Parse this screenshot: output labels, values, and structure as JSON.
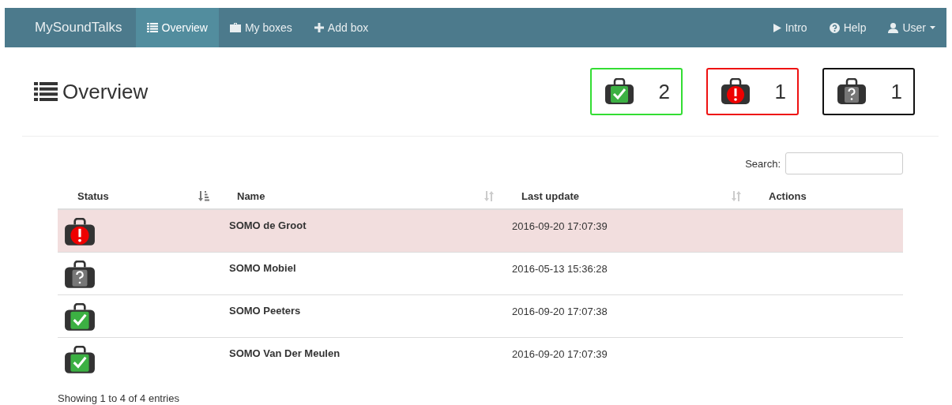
{
  "navbar": {
    "brand": "MySoundTalks",
    "items": [
      {
        "label": "Overview",
        "selected": true
      },
      {
        "label": "My boxes",
        "selected": false
      },
      {
        "label": "Add box",
        "selected": false
      }
    ],
    "right_items": [
      {
        "label": "Intro"
      },
      {
        "label": "Help"
      },
      {
        "label": "User"
      }
    ]
  },
  "page_title": "Overview",
  "counters": [
    {
      "kind": "ok",
      "count": "2"
    },
    {
      "kind": "error",
      "count": "1"
    },
    {
      "kind": "unknown",
      "count": "1"
    }
  ],
  "search": {
    "label": "Search:"
  },
  "table": {
    "columns": [
      {
        "label": "Status",
        "kind": "sorted"
      },
      {
        "label": "Name",
        "kind": "sortable"
      },
      {
        "label": "Last update",
        "kind": "sortable"
      },
      {
        "label": "Actions",
        "kind": "plain"
      }
    ],
    "rows": [
      {
        "kind": "error",
        "name": "SOMO de Groot",
        "last_update": "2016-09-20 17:07:39"
      },
      {
        "kind": "unknown",
        "name": "SOMO Mobiel",
        "last_update": "2016-05-13 15:36:28"
      },
      {
        "kind": "ok",
        "name": "SOMO Peeters",
        "last_update": "2016-09-20 17:07:38"
      },
      {
        "kind": "ok",
        "name": "SOMO Van Der Meulen",
        "last_update": "2016-09-20 17:07:39"
      }
    ]
  },
  "footer_info": "Showing 1 to 4 of 4 entries"
}
